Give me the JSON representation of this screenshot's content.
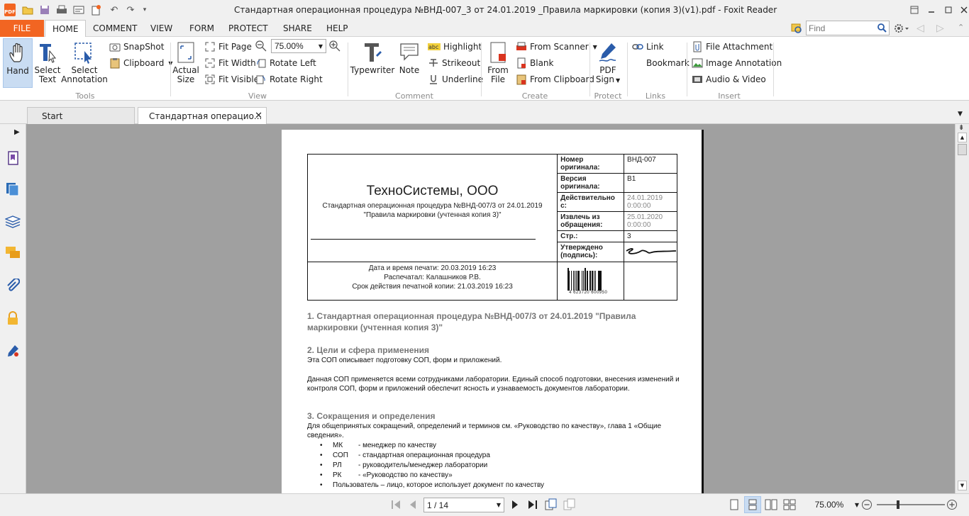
{
  "window": {
    "title": "Стандартная операционная процедура №ВНД-007_3 от 24.01.2019 _Правила маркировки (копия 3)(v1).pdf - Foxit Reader"
  },
  "menu": {
    "tabs": [
      "FILE",
      "HOME",
      "COMMENT",
      "VIEW",
      "FORM",
      "PROTECT",
      "SHARE",
      "HELP"
    ],
    "find_placeholder": "Find"
  },
  "ribbon": {
    "tools": {
      "hand": "Hand",
      "select_text_1": "Select",
      "select_text_2": "Text",
      "select_ann_1": "Select",
      "select_ann_2": "Annotation",
      "snapshot": "SnapShot",
      "clipboard": "Clipboard",
      "group": "Tools"
    },
    "view": {
      "actual_1": "Actual",
      "actual_2": "Size",
      "fit_page": "Fit Page",
      "fit_width": "Fit Width",
      "fit_visible": "Fit Visible",
      "zoom": "75.00%",
      "rotate_left": "Rotate Left",
      "rotate_right": "Rotate Right",
      "group": "View"
    },
    "comment": {
      "typewriter": "Typewriter",
      "note": "Note",
      "highlight": "Highlight",
      "strikeout": "Strikeout",
      "underline": "Underline",
      "group": "Comment"
    },
    "create": {
      "from_file_1": "From",
      "from_file_2": "File",
      "from_scanner": "From Scanner",
      "blank": "Blank",
      "from_clipboard": "From Clipboard",
      "group": "Create"
    },
    "protect": {
      "pdf_sign_1": "PDF",
      "pdf_sign_2": "Sign",
      "group": "Protect"
    },
    "links": {
      "link": "Link",
      "bookmark": "Bookmark",
      "group": "Links"
    },
    "insert": {
      "file_attachment": "File Attachment",
      "image_annotation": "Image Annotation",
      "audio_video": "Audio & Video",
      "group": "Insert"
    }
  },
  "doc_tabs": [
    "Start",
    "Стандартная операцио..."
  ],
  "document": {
    "company": "ТехноСистемы, ООО",
    "subtitle_1": "Стандартная операционная процедура №ВНД-007/3 от 24.01.2019",
    "subtitle_2": "\"Правила маркировки (учтенная копия 3)\"",
    "print_1": "Дата и время печати: 20.03.2019 16:23",
    "print_2": "Распечатал: Калашников Р.В.",
    "print_3": "Срок действия печатной копии: 21.03.2019 16:23",
    "meta": [
      {
        "label": "Номер оригинала:",
        "value": "ВНД-007",
        "grey": false
      },
      {
        "label": "Версия оригинала:",
        "value": "В1",
        "grey": false
      },
      {
        "label": "Действительно с:",
        "value": "24.01.2019 0:00:00",
        "grey": true
      },
      {
        "label": "Извлечь из обращения:",
        "value": "25.01.2020 0:00:00",
        "grey": true
      },
      {
        "label": "Стр.:",
        "value": "3",
        "grey": false
      },
      {
        "label": "Утверждено (подпись):",
        "value": "",
        "grey": false
      }
    ],
    "barcode_digits": "4 623720 600950",
    "s1_title": "1. Стандартная операционная процедура №ВНД-007/3 от 24.01.2019 \"Правила маркировки (учтенная копия 3)\"",
    "s2_title": "2. Цели и сфера применения",
    "s2_p1": "Эта СОП описывает подготовку СОП, форм и приложений.",
    "s2_p2": "Данная СОП применяется всеми сотрудниками лаборатории. Единый способ подготовки, внесения изменений и контроля СОП, форм и приложений обеспечит ясность и узнаваемость документов лаборатории.",
    "s3_title": "3. Сокращения и определения",
    "s3_p1": "Для общепринятых сокращений, определений и терминов см. «Руководство по качеству», глава 1 «Общие сведения».",
    "abbr": [
      {
        "k": "МК",
        "v": "- менеджер по качеству"
      },
      {
        "k": "СОП",
        "v": "- стандартная операционная процедура"
      },
      {
        "k": "РЛ",
        "v": "- руководитель/менеджер лаборатории"
      },
      {
        "k": "РК",
        "v": "- «Руководство по качеству»"
      }
    ],
    "abbr_last": "Пользователь – лицо, которое использует документ по качеству"
  },
  "status": {
    "page": "1 / 14",
    "zoom": "75.00%"
  },
  "colors": {
    "file_tab": "#f26522",
    "viewer_bg": "#a0a0a0"
  }
}
